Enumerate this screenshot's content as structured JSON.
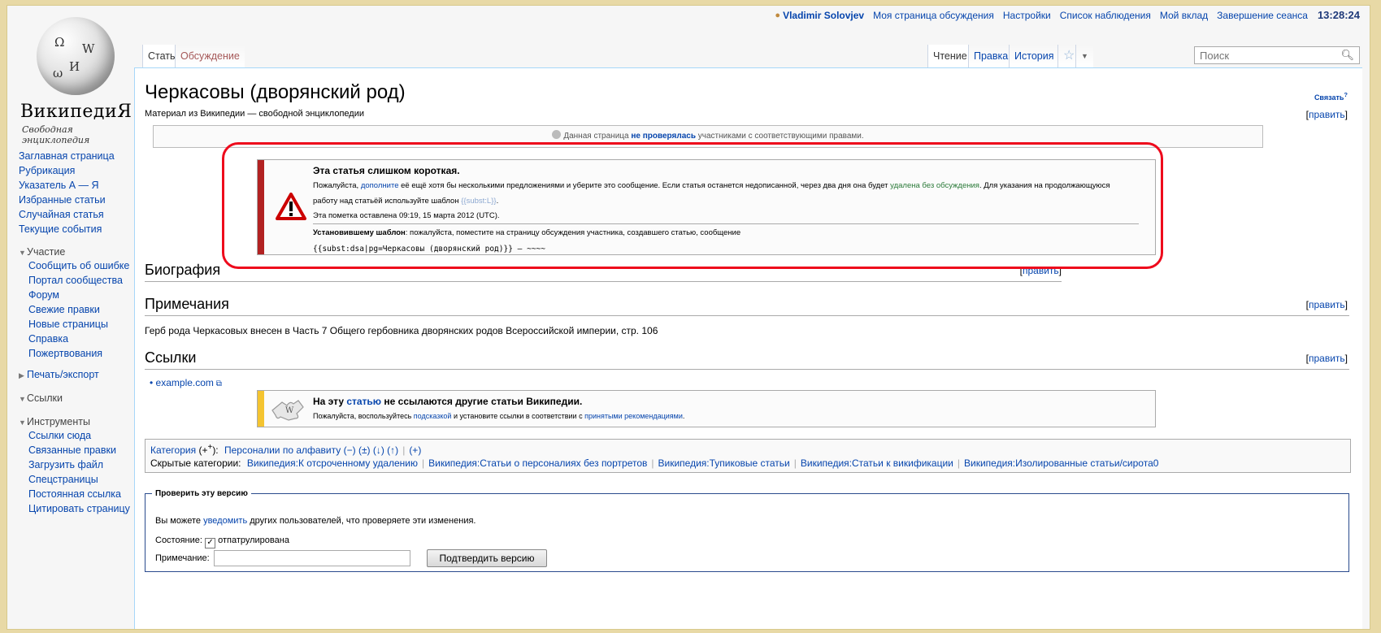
{
  "userbar": {
    "user": "Vladimir Solovjev",
    "links": [
      "Моя страница обсуждения",
      "Настройки",
      "Список наблюдения",
      "Мой вклад",
      "Завершение сеанса"
    ],
    "clock": "13:28:24"
  },
  "logo": {
    "wordmark": "ВикипедиЯ",
    "tagline": "Свободная энциклопедия"
  },
  "sidebar": {
    "main": [
      "Заглавная страница",
      "Рубрикация",
      "Указатель А — Я",
      "Избранные статьи",
      "Случайная статья",
      "Текущие события"
    ],
    "participation": {
      "title": "Участие",
      "items": [
        "Сообщить об ошибке",
        "Портал сообщества",
        "Форум",
        "Свежие правки",
        "Новые страницы",
        "Справка",
        "Пожертвования"
      ]
    },
    "print": "Печать/экспорт",
    "links": "Ссылки",
    "tools": {
      "title": "Инструменты",
      "items": [
        "Ссылки сюда",
        "Связанные правки",
        "Загрузить файл",
        "Спецстраницы",
        "Постоянная ссылка",
        "Цитировать страницу"
      ]
    }
  },
  "tabs": {
    "article": "Статья",
    "talk": "Обсуждение",
    "read": "Чтение",
    "edit": "Правка",
    "history": "История",
    "search_placeholder": "Поиск"
  },
  "article": {
    "title": "Черкасовы (дворянский род)",
    "subtitle": "Материал из Википедии — свободной энциклопедии",
    "link_label": "Связать",
    "edit_label": "править",
    "review": {
      "before": "Данная страница ",
      "link": "не проверялась",
      "after": " участниками с соответствующими правами."
    },
    "short_box": {
      "title": "Эта статья слишком короткая.",
      "line1_a": "Пожалуйста, ",
      "line1_link": "дополните",
      "line1_b": " её ещё хотя бы несколькими предложениями и уберите это сообщение. Если статья останется недописанной, через два дня она будет ",
      "line1_link2": "удалена без обсуждения",
      "line1_c": ". Для указания на продолжающуюся",
      "line2_a": "работу над статьёй используйте шаблон ",
      "line2_tpl": "{{subst:L}}",
      "line2_b": ".",
      "line3": "Эта пометка оставлена 09:19, 15 марта 2012 (UTC).",
      "line4_bold": "Установившему шаблон",
      "line4": ": пожалуйста, поместите на страницу обсуждения участника, создавшего статью, сообщение",
      "code": "{{subst:dsa|pg=Черкасовы (дворянский род)}} — ~~~~"
    },
    "sections": {
      "bio": "Биография",
      "notes": "Примечания",
      "links": "Ссылки"
    },
    "notes_text": "Герб рода Черкасовых внесен в Часть 7 Общего гербовника дворянских родов Всероссийской империи, стр. 106",
    "ext_link": "example.com",
    "orphan_box": {
      "title_a": "На эту ",
      "title_link": "статью",
      "title_b": " не ссылаются другие статьи Википедии.",
      "line_a": "Пожалуйста, воспользуйтесь ",
      "line_link": "подсказкой",
      "line_b": " и установите ссылки в соответствии с ",
      "line_link2": "принятыми рекомендациями",
      "line_c": "."
    },
    "categories": {
      "label": "Категория",
      "plus": "(+",
      "plus_sup": "+",
      "plus_end": "):",
      "item": "Персоналии по алфавиту",
      "nav": "(−) (±) (↓) (↑)",
      "add": "(+)",
      "hidden_label": "Скрытые категории:",
      "hidden": [
        "Википедия:К отсроченному удалению",
        "Википедия:Статьи о персоналиях без портретов",
        "Википедия:Тупиковые статьи",
        "Википедия:Статьи к викификации",
        "Википедия:Изолированные статьи/сирота0"
      ]
    },
    "review_form": {
      "legend": "Проверить эту версию",
      "text_a": "Вы можете ",
      "text_link": "уведомить",
      "text_b": " других пользователей, что проверяете эти изменения.",
      "state_label": "Состояние:",
      "state_value": "отпатрулирована",
      "comment_label": "Примечание:",
      "button": "Подтвердить версию"
    }
  },
  "colors": {
    "link": "#0645ad",
    "delete_bar": "#b22222",
    "orphan_bar": "#f4c430",
    "annotation_ring": "#ee0a1c"
  }
}
